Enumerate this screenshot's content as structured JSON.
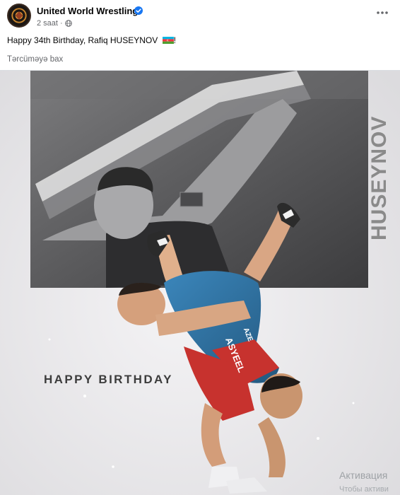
{
  "post": {
    "page_name": "United World Wrestling",
    "time": "2 saat",
    "separator": "·",
    "text": "Happy 34th Birthday, Rafiq HUSEYNOV",
    "text_suffix": "!",
    "see_translation": "Tərcüməyə bax"
  },
  "image": {
    "headline": "HAPPY BIRTHDAY",
    "vertical_name": "HUSEYNOV",
    "singlet_text": "ASYEEL",
    "singlet_code": "AZE"
  },
  "system_overlay": {
    "line1": "Активация",
    "line2": "Чтобы активи"
  },
  "icons": {
    "avatar": "uww-logo-icon",
    "verified": "verified-badge-icon",
    "privacy": "globe-icon",
    "menu": "more-options-icon",
    "flag": "azerbaijan-flag-icon"
  },
  "colors": {
    "verified": "#1877f2",
    "meta_text": "#65676b",
    "image_background": "#e9e8ea",
    "photo_panel": "#5a5a5c",
    "singlet_blue": "#2f6f9f",
    "singlet_red": "#c7322e"
  }
}
